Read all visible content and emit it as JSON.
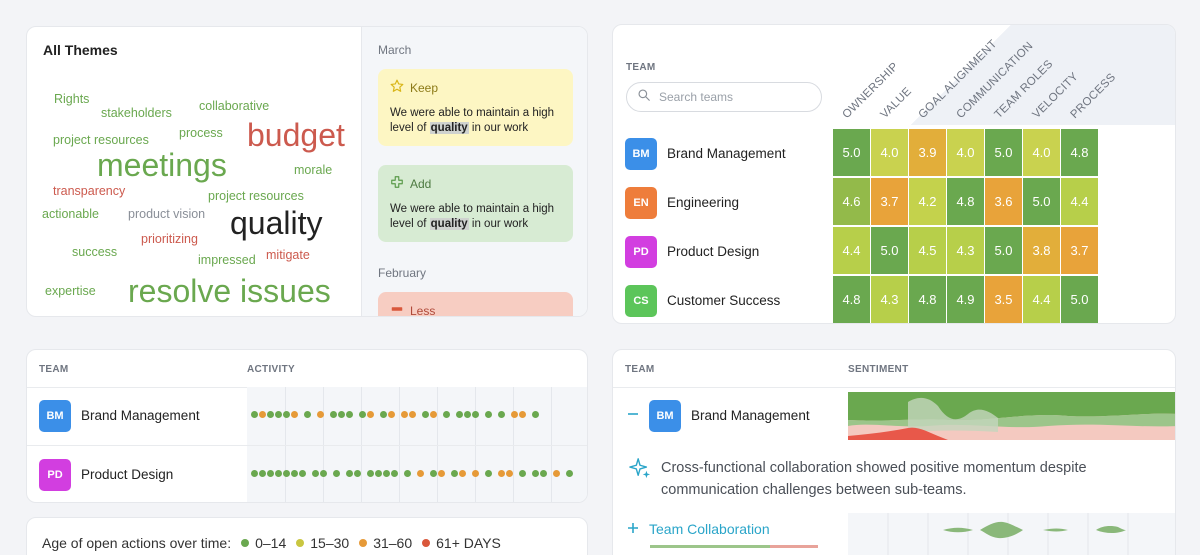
{
  "themes": {
    "title": "All Themes",
    "words": [
      {
        "text": "Rights",
        "tone": "g"
      },
      {
        "text": "stakeholders",
        "tone": "g"
      },
      {
        "text": "collaborative",
        "tone": "g"
      },
      {
        "text": "project resources",
        "tone": "g"
      },
      {
        "text": "process",
        "tone": "g"
      },
      {
        "text": "budget",
        "tone": "r"
      },
      {
        "text": "meetings",
        "tone": "g"
      },
      {
        "text": "morale",
        "tone": "g"
      },
      {
        "text": "transparency",
        "tone": "r"
      },
      {
        "text": "project resources",
        "tone": "g"
      },
      {
        "text": "actionable",
        "tone": "g"
      },
      {
        "text": "product vision",
        "tone": "gr"
      },
      {
        "text": "quality",
        "tone": "k"
      },
      {
        "text": "prioritizing",
        "tone": "r"
      },
      {
        "text": "success",
        "tone": "g"
      },
      {
        "text": "mitigate",
        "tone": "r"
      },
      {
        "text": "impressed",
        "tone": "g"
      },
      {
        "text": "expertise",
        "tone": "g"
      },
      {
        "text": "resolve issues",
        "tone": "g"
      }
    ]
  },
  "retro": {
    "month1": "March",
    "month2": "February",
    "keep": {
      "label": "Keep",
      "text_before": "We were able to maintain a high level of ",
      "highlight": "quality",
      "text_after": " in our work"
    },
    "add": {
      "label": "Add",
      "text_before": "We were able to maintain a high level of ",
      "highlight": "quality",
      "text_after": " in our work"
    },
    "less": {
      "label": "Less"
    }
  },
  "matrix": {
    "team_header": "TEAM",
    "search_placeholder": "Search teams",
    "columns": [
      "OWNERSHIP",
      "VALUE",
      "GOAL ALIGNMENT",
      "COMMUNICATION",
      "TEAM ROLES",
      "VELOCITY",
      "PROCESS"
    ],
    "teams": [
      {
        "code": "BM",
        "name": "Brand Management",
        "color": "#3b8fe8",
        "scores": [
          5.0,
          4.0,
          3.9,
          4.0,
          5.0,
          4.0,
          4.8
        ]
      },
      {
        "code": "EN",
        "name": "Engineering",
        "color": "#ee7d3b",
        "scores": [
          4.6,
          3.7,
          4.2,
          4.8,
          3.6,
          5.0,
          4.4
        ]
      },
      {
        "code": "PD",
        "name": "Product Design",
        "color": "#d23ee0",
        "scores": [
          4.4,
          5.0,
          4.5,
          4.3,
          5.0,
          3.8,
          3.7
        ]
      },
      {
        "code": "CS",
        "name": "Customer Success",
        "color": "#5cc55a",
        "scores": [
          4.8,
          4.3,
          4.8,
          4.9,
          3.5,
          4.4,
          5.0
        ]
      }
    ]
  },
  "activity": {
    "team_header": "TEAM",
    "activity_header": "ACTIVITY",
    "teams": [
      {
        "code": "BM",
        "name": "Brand Management",
        "color": "#3b8fe8"
      },
      {
        "code": "PD",
        "name": "Product Design",
        "color": "#d23ee0"
      }
    ]
  },
  "legend": {
    "label": "Age of open actions over time:",
    "items": [
      {
        "label": "0–14",
        "color": "#6aa84f"
      },
      {
        "label": "15–30",
        "color": "#c9c640"
      },
      {
        "label": "31–60",
        "color": "#e69a38"
      },
      {
        "label": "61+ DAYS",
        "color": "#d9573b"
      }
    ]
  },
  "sentiment": {
    "team_header": "TEAM",
    "sentiment_header": "SENTIMENT",
    "team": {
      "code": "BM",
      "name": "Brand Management",
      "color": "#3b8fe8"
    },
    "insight": "Cross-functional collaboration showed positive momentum despite communication challenges between sub-teams.",
    "theme_label": "Team Collaboration"
  }
}
